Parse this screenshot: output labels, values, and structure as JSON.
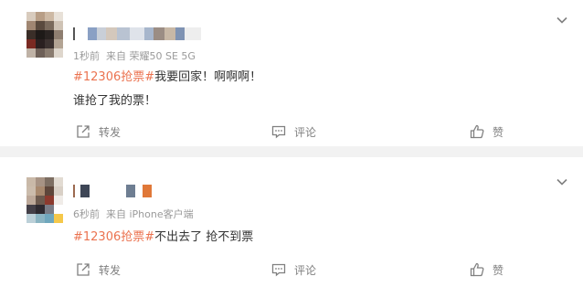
{
  "posts": [
    {
      "meta": {
        "time": "1秒前",
        "source": "来自 荣耀50 SE 5G"
      },
      "hashtag": "#12306抢票#",
      "text_line1": "我要回家！啊啊啊！",
      "text_line2": "谁抢了我的票！",
      "actions": {
        "repost": "转发",
        "comment": "评论",
        "like": "赞"
      }
    },
    {
      "meta": {
        "time": "6秒前",
        "source": "来自 iPhone客户端"
      },
      "hashtag": "#12306抢票#",
      "text_line1": "不出去了 抢不到票",
      "actions": {
        "repost": "转发",
        "comment": "评论",
        "like": "赞"
      }
    }
  ],
  "colors": {
    "hashtag": "#eb7350",
    "meta": "#9a9a9a",
    "text": "#333333",
    "action": "#808080"
  },
  "icons": [
    "chevron-down-icon",
    "repost-icon",
    "comment-icon",
    "like-icon"
  ]
}
